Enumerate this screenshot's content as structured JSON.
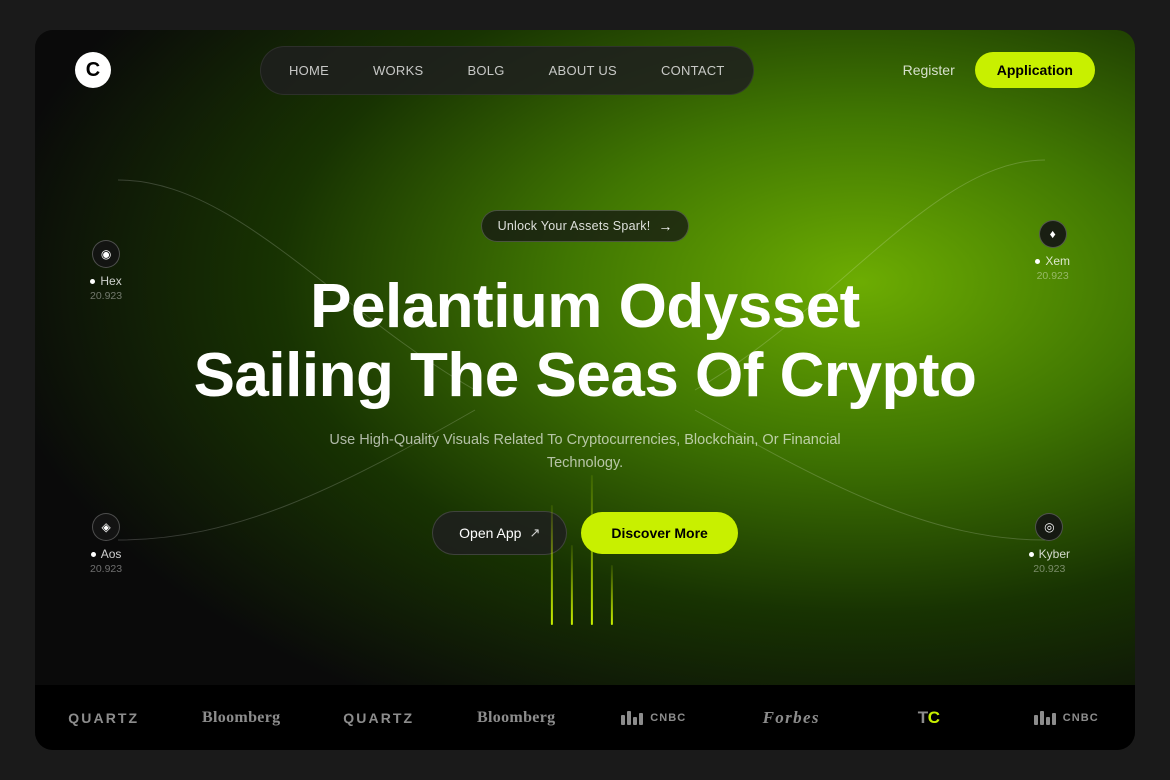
{
  "page": {
    "background_color": "#1a1a1a"
  },
  "logo": {
    "symbol": "C"
  },
  "navbar": {
    "links": [
      {
        "label": "HOME",
        "id": "home"
      },
      {
        "label": "WORKS",
        "id": "works"
      },
      {
        "label": "BOLG",
        "id": "bolg"
      },
      {
        "label": "ABOUT US",
        "id": "about"
      },
      {
        "label": "CONTACT",
        "id": "contact"
      }
    ],
    "register_label": "Register",
    "application_label": "Application"
  },
  "hero": {
    "badge_text": "Unlock Your Assets Spark!",
    "title_line1": "Pelantium Odysset",
    "title_line2": "Sailing The Seas Of Crypto",
    "subtitle": "Use High-Quality Visuals Related To Cryptocurrencies, Blockchain, Or Financial Technology.",
    "open_app_label": "Open App",
    "discover_more_label": "Discover More"
  },
  "nodes": [
    {
      "id": "hex",
      "label": "Hex",
      "value": "20.923",
      "icon": "◉",
      "position": "top-left"
    },
    {
      "id": "xem",
      "label": "Xem",
      "value": "20.923",
      "icon": "♦",
      "position": "top-right"
    },
    {
      "id": "aos",
      "label": "Aos",
      "value": "20.923",
      "icon": "◈",
      "position": "bottom-left"
    },
    {
      "id": "kyber",
      "label": "Kyber",
      "value": "20.923",
      "icon": "◎",
      "position": "bottom-right"
    }
  ],
  "logos_bar": {
    "items": [
      {
        "label": "QUARTZ",
        "style": "quartz"
      },
      {
        "label": "Bloomberg",
        "style": "bloomberg"
      },
      {
        "label": "QUARTZ",
        "style": "quartz"
      },
      {
        "label": "Bloomberg",
        "style": "bloomberg"
      },
      {
        "label": "CNBC",
        "style": "cnbc"
      },
      {
        "label": "Forbes",
        "style": "forbes"
      },
      {
        "label": "TechCrunch",
        "style": "tc"
      },
      {
        "label": "CNBC",
        "style": "cnbc2"
      }
    ]
  }
}
